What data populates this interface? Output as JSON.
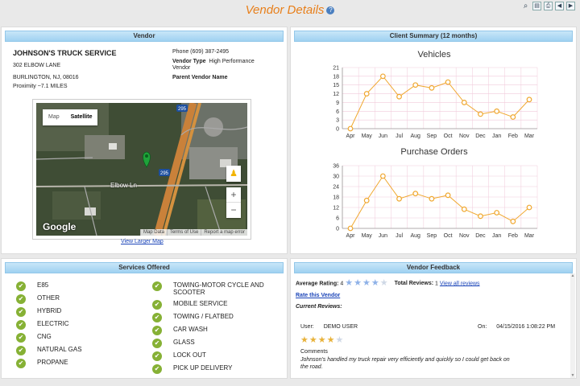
{
  "page": {
    "title": "Vendor Details",
    "help_icon": "?"
  },
  "toolbar": {
    "icons": [
      "binoculars-icon",
      "document-icon",
      "print-icon",
      "back-icon",
      "forward-icon"
    ]
  },
  "vendor": {
    "header": "Vendor",
    "name": "JOHNSON'S TRUCK SERVICE",
    "address1": "302 ELBOW LANE",
    "address2": "BURLINGTON, NJ, 08016",
    "proximity": "Proximity ~7.1 MILES",
    "phone": "Phone (609) 387-2495",
    "type_label": "Vendor Type",
    "type_value": "High Performance Vendor",
    "parent_label": "Parent Vendor Name",
    "map": {
      "tab_map": "Map",
      "tab_satellite": "Satellite",
      "road_label": "Elbow Ln",
      "google": "Google",
      "map_data": "Map Data",
      "terms": "Terms of Use",
      "report": "Report a map error",
      "zoom_in": "+",
      "zoom_out": "−",
      "highway_shield_1": "295",
      "highway_shield_2": "295"
    },
    "view_larger": "View Larger Map"
  },
  "summary": {
    "header": "Client Summary (12 months)",
    "vehicles_title": "Vehicles",
    "orders_title": "Purchase Orders"
  },
  "chart_data": [
    {
      "type": "line",
      "title": "Vehicles",
      "categories": [
        "Apr",
        "May",
        "Jun",
        "Jul",
        "Aug",
        "Sep",
        "Oct",
        "Nov",
        "Dec",
        "Jan",
        "Feb",
        "Mar"
      ],
      "values": [
        0,
        12,
        18,
        11,
        15,
        14,
        16,
        9,
        5,
        6,
        4,
        10
      ],
      "yticks": [
        0,
        3,
        6,
        9,
        12,
        15,
        18,
        21
      ],
      "ylim": [
        0,
        21
      ],
      "color": "#f0a830"
    },
    {
      "type": "line",
      "title": "Purchase Orders",
      "categories": [
        "Apr",
        "May",
        "Jun",
        "Jul",
        "Aug",
        "Sep",
        "Oct",
        "Nov",
        "Dec",
        "Jan",
        "Feb",
        "Mar"
      ],
      "values": [
        0,
        16,
        30,
        17,
        20,
        17,
        19,
        11,
        7,
        9,
        4,
        12
      ],
      "yticks": [
        0,
        6,
        12,
        18,
        24,
        30,
        36
      ],
      "ylim": [
        0,
        36
      ],
      "color": "#f0a830"
    }
  ],
  "services": {
    "header": "Services Offered",
    "left": [
      "E85",
      "OTHER",
      "HYBRID",
      "ELECTRIC",
      "CNG",
      "NATURAL GAS",
      "PROPANE"
    ],
    "right": [
      "TOWING-MOTOR CYCLE AND SCOOTER",
      "MOBILE SERVICE",
      "TOWING / FLATBED",
      "CAR WASH",
      "GLASS",
      "LOCK OUT",
      "PICK UP DELIVERY"
    ]
  },
  "feedback": {
    "header": "Vendor Feedback",
    "avg_label": "Average Rating:",
    "avg_value": "4",
    "avg_rating": 4,
    "total_label": "Total Reviews:",
    "total_value": "1",
    "view_all": "View all reviews",
    "rate_link": "Rate this Vendor",
    "current_label": "Current Reviews:",
    "review": {
      "user_label": "User:",
      "user": "DEMO USER",
      "on_label": "On:",
      "date": "04/15/2016 1:08:22 PM",
      "rating": 4,
      "comments_label": "Comments",
      "comment": "Johnson's handled my truck repair very efficiently and quickly so I could get back on the road."
    }
  }
}
